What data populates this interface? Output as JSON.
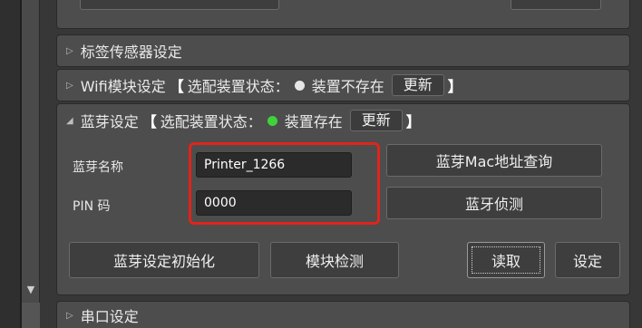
{
  "panels": {
    "label_sensor": {
      "title": "标签传感器设定"
    },
    "wifi": {
      "title": "Wifi模块设定",
      "bracket_open": "【",
      "status_label": "选配装置状态：",
      "status_text": "装置不存在",
      "update_button": "更新",
      "bracket_close": "】",
      "status_color": "#e6e6e6"
    },
    "bluetooth": {
      "title": "蓝芽设定",
      "bracket_open": "【",
      "status_label": "选配装置状态：",
      "status_text": "装置存在",
      "update_button": "更新",
      "bracket_close": "】",
      "status_color": "#3fd23a",
      "name_label": "蓝芽名称",
      "name_value": "Printer_1266",
      "pin_label": "PIN 码",
      "pin_value": "0000",
      "mac_query_button": "蓝芽Mac地址查询",
      "detect_button": "蓝牙侦测",
      "init_button": "蓝芽设定初始化",
      "module_check_button": "模块检测",
      "read_button": "读取",
      "set_button": "设定"
    },
    "serial": {
      "title": "串口设定"
    }
  },
  "highlight_color": "#e0241b"
}
